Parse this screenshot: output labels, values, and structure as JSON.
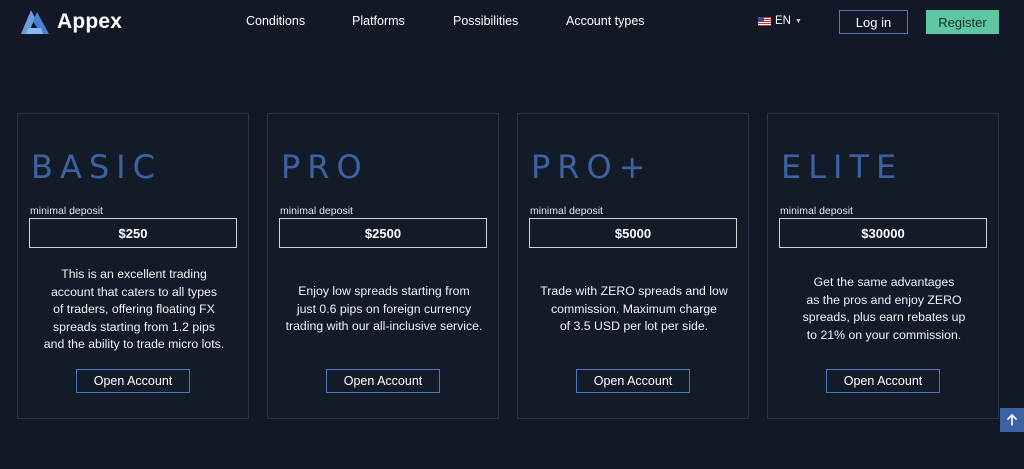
{
  "brand": {
    "name": "Appex",
    "logo_icon": "appex-logo-icon",
    "accent_color": "#3d62a4"
  },
  "nav": {
    "items": [
      {
        "label": "Conditions"
      },
      {
        "label": "Platforms"
      },
      {
        "label": "Possibilities"
      },
      {
        "label": "Account types"
      }
    ]
  },
  "language": {
    "code": "EN",
    "flag_icon": "us-flag-icon"
  },
  "auth": {
    "login_label": "Log in",
    "register_label": "Register",
    "register_color": "#5ec7a2"
  },
  "plans": [
    {
      "name": "BASIC",
      "deposit_label": "minimal deposit",
      "deposit": "$250",
      "description": [
        "This is an excellent trading",
        "account that caters to all types",
        "of traders, offering floating FX",
        "spreads starting from 1.2 pips",
        "and the ability to trade micro lots."
      ],
      "cta": "Open Account"
    },
    {
      "name": "PRO",
      "deposit_label": "minimal deposit",
      "deposit": "$2500",
      "description": [
        "Enjoy low spreads starting from",
        "just 0.6 pips on foreign currency",
        "trading with our all-inclusive service."
      ],
      "cta": "Open Account"
    },
    {
      "name": "PRO+",
      "deposit_label": "minimal deposit",
      "deposit": "$5000",
      "description": [
        "Trade with ZERO spreads and low",
        "commission. Maximum charge",
        "of 3.5 USD per lot per side."
      ],
      "cta": "Open Account"
    },
    {
      "name": "ELITE",
      "deposit_label": "minimal deposit",
      "deposit": "$30000",
      "description": [
        "Get the same advantages",
        "as the pros and enjoy ZERO",
        "spreads, plus earn rebates up",
        "to 21% on your commission."
      ],
      "cta": "Open Account"
    }
  ],
  "scroll_top_icon": "arrow-up-icon"
}
